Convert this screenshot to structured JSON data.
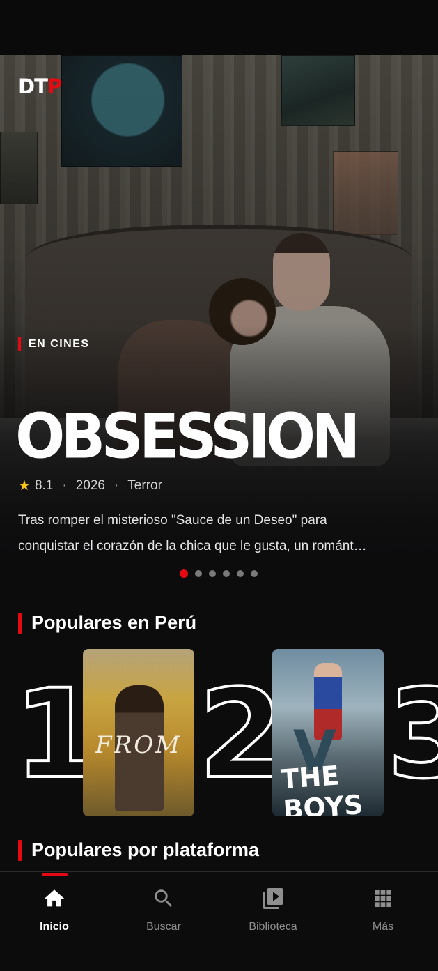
{
  "app": {
    "logo_main": "DT",
    "logo_accent": "P"
  },
  "hero": {
    "tag": "EN CINES",
    "title": "OBSESSION",
    "rating": "8.1",
    "year": "2026",
    "genre": "Terror",
    "description_line1": "Tras romper el misterioso \"Sauce de un Deseo\" para",
    "description_line2": "conquistar el corazón de la chica que le gusta, un románt…",
    "carousel": {
      "total": 6,
      "active_index": 0
    }
  },
  "popular": {
    "title": "Populares en Perú",
    "items": [
      {
        "rank": "1",
        "poster_text": "FROM"
      },
      {
        "rank": "2",
        "poster_text": "THE BOYS",
        "poster_mark": "V"
      },
      {
        "rank": "3"
      }
    ]
  },
  "platforms": {
    "title": "Populares por plataforma"
  },
  "nav": {
    "items": [
      {
        "label": "Inicio",
        "icon": "home-icon",
        "active": true
      },
      {
        "label": "Buscar",
        "icon": "search-icon",
        "active": false
      },
      {
        "label": "Biblioteca",
        "icon": "library-icon",
        "active": false
      },
      {
        "label": "Más",
        "icon": "grid-icon",
        "active": false
      }
    ]
  },
  "colors": {
    "accent": "#e50914",
    "star": "#f5c518",
    "background": "#0c0c0d"
  }
}
